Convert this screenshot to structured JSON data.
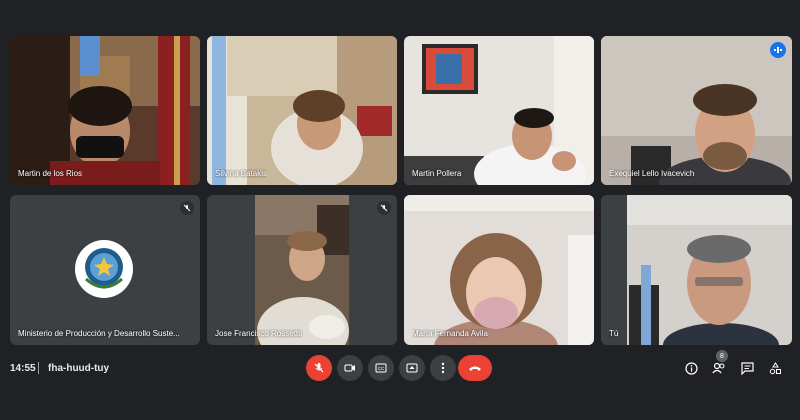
{
  "participants": [
    {
      "name": "Martin de los Rios",
      "muted": false
    },
    {
      "name": "Silvina Batakis",
      "muted": false
    },
    {
      "name": "Martin Pollera",
      "muted": false
    },
    {
      "name": "Exequiel Lello Ivacevich",
      "muted": false,
      "speaking": true
    },
    {
      "name": "Ministerio de Producción y Desarrollo Suste...",
      "muted": true
    },
    {
      "name": "Jose Francisco Rossetto",
      "muted": true
    },
    {
      "name": "María Fernanda Avila",
      "muted": false
    },
    {
      "name": "Tú",
      "muted": true
    }
  ],
  "meeting": {
    "time": "14:55",
    "separator": "|",
    "code": "fha-huud-tuy"
  },
  "controls": {
    "mic_icon": "mic-off-icon",
    "camera_icon": "camera-icon",
    "captions_icon": "captions-icon",
    "present_icon": "present-screen-icon",
    "more_icon": "more-options-icon",
    "leave_icon": "leave-call-icon"
  },
  "side_controls": {
    "people_count": "8"
  },
  "colors": {
    "background": "#202124",
    "tile": "#3c4043",
    "danger": "#ea4335",
    "accent": "#1a73e8"
  }
}
